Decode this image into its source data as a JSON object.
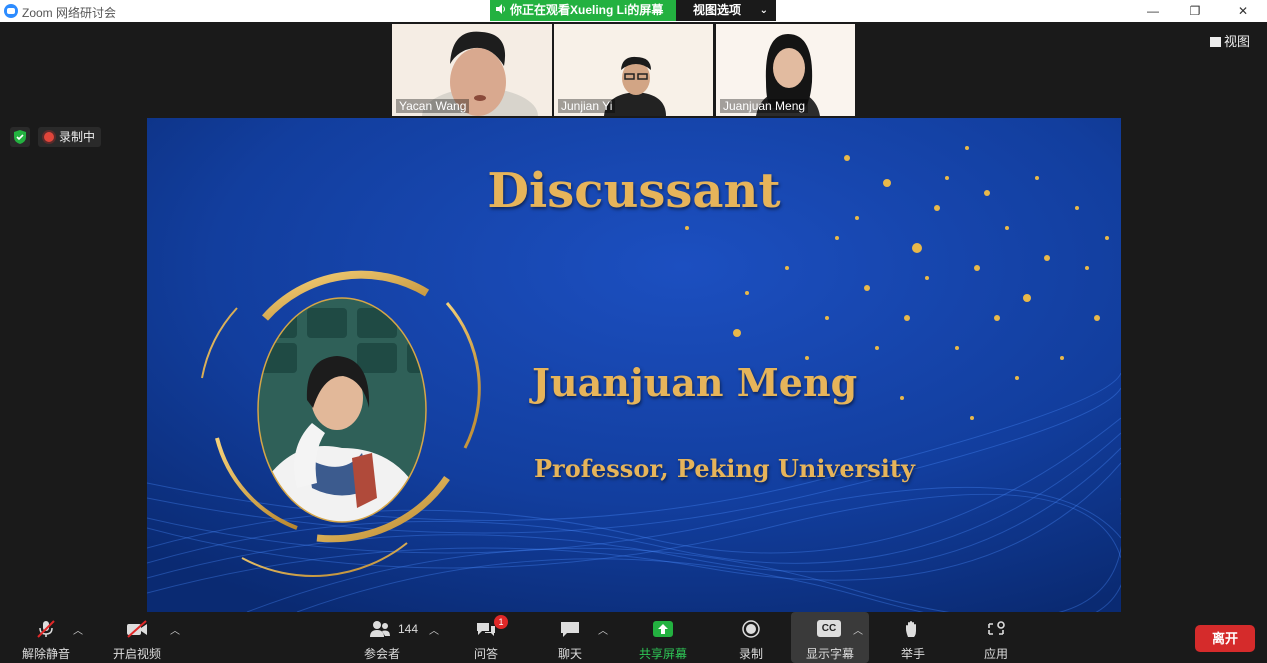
{
  "window": {
    "title": "Zoom 网络研讨会",
    "minimize": "—",
    "restore": "❐",
    "close": "✕"
  },
  "share_banner": {
    "text": "你正在观看Xueling Li的屏幕",
    "view_options": "视图选项"
  },
  "view_button": "视图",
  "recording_label": "录制中",
  "participants": [
    {
      "name": "Yacan Wang",
      "active": true
    },
    {
      "name": "Junjian Yi",
      "active": false
    },
    {
      "name": "Juanjuan Meng",
      "active": false
    }
  ],
  "slide": {
    "title": "Discussant",
    "name": "Juanjuan Meng",
    "subtitle": "Professor, Peking University"
  },
  "toolbar": {
    "unmute": "解除静音",
    "start_video": "开启视频",
    "participants": "参会者",
    "participant_count": "144",
    "qa": "问答",
    "qa_badge": "1",
    "chat": "聊天",
    "share_screen": "共享屏幕",
    "record": "录制",
    "captions": "显示字幕",
    "captions_icon": "CC",
    "raise_hand": "举手",
    "apps": "应用",
    "leave": "离开"
  },
  "colors": {
    "share_green": "#23b140",
    "leave_red": "#d52b2b",
    "slide_blue": "#0e3a9a",
    "gold": "#e6b45a"
  }
}
